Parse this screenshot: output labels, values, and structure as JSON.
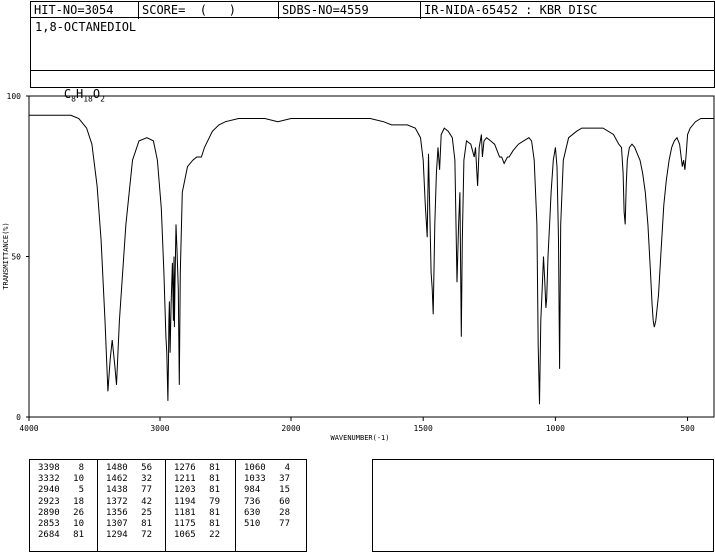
{
  "header": {
    "hit_no": "HIT-NO=3054",
    "score": "SCORE=  (   )",
    "sdbs_no": "SDBS-NO=4559",
    "ir_id": "IR-NIDA-65452 : KBR DISC"
  },
  "compound": {
    "name": "1,8-OCTANEDIOL",
    "formula_parts": [
      "C",
      "8",
      "H",
      "18",
      "O",
      "2"
    ]
  },
  "chart_data": {
    "type": "line",
    "xlabel": "WAVENUMBER(-1)",
    "ylabel": "TRANSMITTANCE(%)",
    "xlim": [
      4000,
      400
    ],
    "ylim": [
      0,
      100
    ],
    "x_ticks": [
      4000,
      3000,
      2000,
      1500,
      1000,
      500
    ],
    "y_ticks": [
      0,
      50,
      100
    ],
    "grid": false,
    "series": [
      {
        "x": [
          4000,
          3800,
          3680,
          3620,
          3560,
          3520,
          3480,
          3450,
          3420,
          3398,
          3380,
          3365,
          3345,
          3332,
          3310,
          3260,
          3210,
          3160,
          3100,
          3050,
          3020,
          2990,
          2970,
          2955,
          2948,
          2940,
          2935,
          2932,
          2928,
          2923,
          2915,
          2905,
          2898,
          2893,
          2890,
          2886,
          2878,
          2870,
          2860,
          2853,
          2845,
          2830,
          2790,
          2750,
          2720,
          2700,
          2684,
          2660,
          2600,
          2550,
          2500,
          2400,
          2300,
          2200,
          2100,
          2000,
          1900,
          1800,
          1700,
          1650,
          1620,
          1600,
          1560,
          1530,
          1510,
          1500,
          1492,
          1485,
          1480,
          1476,
          1470,
          1466,
          1462,
          1456,
          1450,
          1444,
          1438,
          1432,
          1420,
          1405,
          1390,
          1380,
          1376,
          1372,
          1366,
          1361,
          1356,
          1352,
          1346,
          1336,
          1320,
          1307,
          1302,
          1294,
          1288,
          1280,
          1276,
          1270,
          1260,
          1245,
          1230,
          1211,
          1203,
          1194,
          1181,
          1175,
          1160,
          1140,
          1120,
          1100,
          1090,
          1080,
          1070,
          1065,
          1060,
          1055,
          1050,
          1045,
          1040,
          1036,
          1033,
          1028,
          1022,
          1016,
          1008,
          1000,
          994,
          988,
          984,
          980,
          970,
          950,
          920,
          900,
          860,
          820,
          780,
          760,
          750,
          744,
          740,
          736,
          732,
          728,
          720,
          710,
          700,
          690,
          680,
          670,
          660,
          650,
          640,
          634,
          630,
          626,
          620,
          610,
          600,
          590,
          580,
          570,
          560,
          550,
          540,
          530,
          520,
          515,
          510,
          505,
          500,
          490,
          470,
          450,
          430,
          410,
          400
        ],
        "y": [
          94,
          94,
          94,
          93,
          90,
          85,
          72,
          55,
          30,
          8,
          18,
          24,
          16,
          10,
          30,
          60,
          80,
          86,
          87,
          86,
          80,
          65,
          45,
          25,
          20,
          5,
          18,
          30,
          36,
          20,
          35,
          48,
          30,
          50,
          28,
          40,
          60,
          52,
          40,
          10,
          45,
          70,
          78,
          80,
          81,
          81,
          81,
          84,
          89,
          91,
          92,
          93,
          93,
          93,
          92,
          93,
          93,
          93,
          93,
          92,
          91,
          91,
          91,
          90,
          87,
          80,
          66,
          56,
          82,
          68,
          45,
          40,
          32,
          60,
          76,
          84,
          77,
          88,
          90,
          89,
          87,
          80,
          60,
          42,
          60,
          70,
          25,
          55,
          80,
          86,
          85,
          81,
          84,
          72,
          84,
          88,
          81,
          86,
          87,
          86,
          85,
          81,
          81,
          79,
          81,
          81,
          83,
          85,
          86,
          87,
          86,
          80,
          60,
          22,
          4,
          30,
          40,
          50,
          42,
          34,
          37,
          50,
          60,
          70,
          80,
          84,
          78,
          55,
          15,
          60,
          80,
          87,
          89,
          90,
          90,
          90,
          88,
          85,
          84,
          76,
          64,
          60,
          72,
          80,
          84,
          85,
          84,
          82,
          80,
          76,
          70,
          60,
          45,
          35,
          30,
          28,
          30,
          38,
          52,
          66,
          74,
          80,
          84,
          86,
          87,
          85,
          78,
          80,
          77,
          82,
          88,
          90,
          92,
          93,
          93,
          93,
          93
        ]
      }
    ]
  },
  "peaks": {
    "col1": [
      [
        "3398",
        "8"
      ],
      [
        "3332",
        "10"
      ],
      [
        "2940",
        "5"
      ],
      [
        "2923",
        "18"
      ],
      [
        "2890",
        "26"
      ],
      [
        "2853",
        "10"
      ],
      [
        "2684",
        "81"
      ]
    ],
    "col2": [
      [
        "1480",
        "56"
      ],
      [
        "1462",
        "32"
      ],
      [
        "1438",
        "77"
      ],
      [
        "1372",
        "42"
      ],
      [
        "1356",
        "25"
      ],
      [
        "1307",
        "81"
      ],
      [
        "1294",
        "72"
      ]
    ],
    "col3": [
      [
        "1276",
        "81"
      ],
      [
        "1211",
        "81"
      ],
      [
        "1203",
        "81"
      ],
      [
        "1194",
        "79"
      ],
      [
        "1181",
        "81"
      ],
      [
        "1175",
        "81"
      ],
      [
        "1065",
        "22"
      ]
    ],
    "col4": [
      [
        "1060",
        "4"
      ],
      [
        "1033",
        "37"
      ],
      [
        "984",
        "15"
      ],
      [
        "736",
        "60"
      ],
      [
        "630",
        "28"
      ],
      [
        "510",
        "77"
      ]
    ]
  }
}
